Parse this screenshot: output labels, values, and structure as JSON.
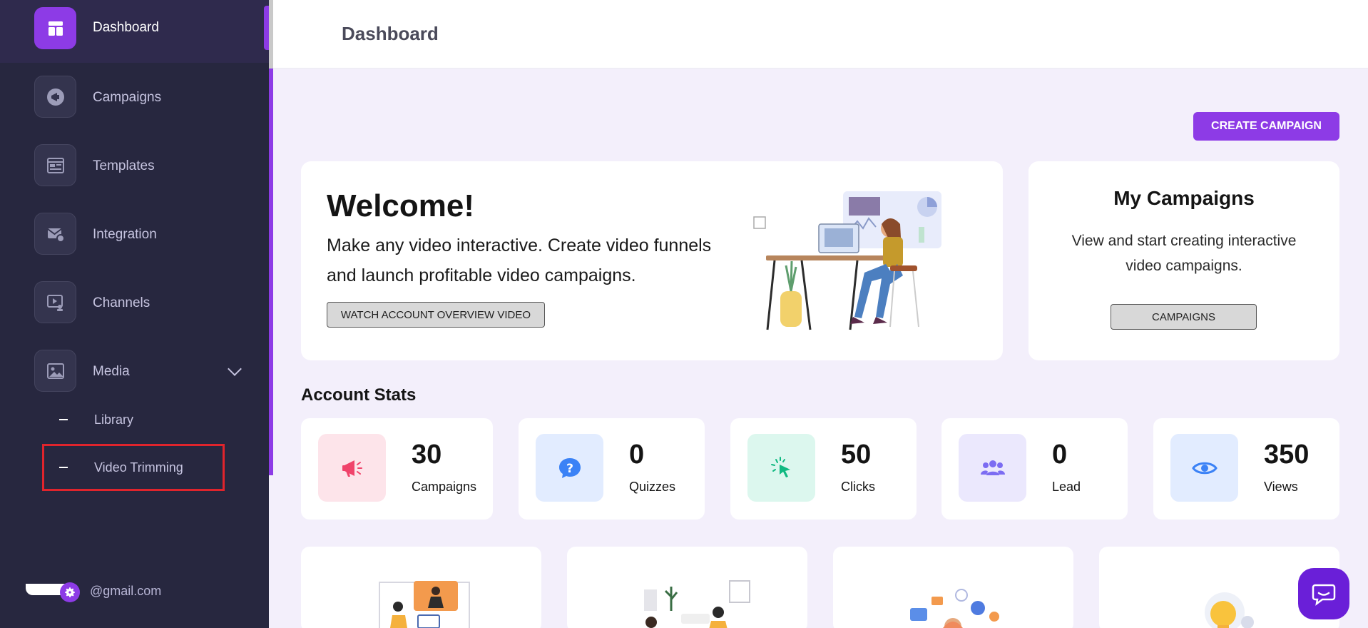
{
  "sidebar": {
    "items": [
      {
        "label": "Dashboard",
        "icon": "dashboard-icon"
      },
      {
        "label": "Campaigns",
        "icon": "megaphone-icon"
      },
      {
        "label": "Templates",
        "icon": "template-icon"
      },
      {
        "label": "Integration",
        "icon": "integration-icon"
      },
      {
        "label": "Channels",
        "icon": "channels-icon"
      },
      {
        "label": "Media",
        "icon": "media-icon"
      }
    ],
    "media_sub": [
      {
        "label": "Library"
      },
      {
        "label": "Video Trimming"
      }
    ],
    "profile_email": "@gmail.com"
  },
  "header": {
    "title": "Dashboard"
  },
  "actions": {
    "create_campaign": "CREATE CAMPAIGN"
  },
  "welcome": {
    "title": "Welcome!",
    "text": "Make any video interactive. Create video funnels and launch profitable video campaigns.",
    "button": "WATCH ACCOUNT OVERVIEW VIDEO"
  },
  "my_campaigns": {
    "title": "My Campaigns",
    "text": "View and start creating interactive video campaigns.",
    "button": "CAMPAIGNS"
  },
  "account_stats": {
    "title": "Account Stats",
    "items": [
      {
        "value": "30",
        "label": "Campaigns",
        "color": "#f0436b",
        "bg": "#fde4ea"
      },
      {
        "value": "0",
        "label": "Quizzes",
        "color": "#3b82f6",
        "bg": "#e2ecff"
      },
      {
        "value": "50",
        "label": "Clicks",
        "color": "#10b981",
        "bg": "#dcf7ee"
      },
      {
        "value": "0",
        "label": "Lead",
        "color": "#7c6cf2",
        "bg": "#ebe8fd"
      },
      {
        "value": "350",
        "label": "Views",
        "color": "#3b82f6",
        "bg": "#e2ecff"
      }
    ]
  },
  "colors": {
    "accent": "#8d3be6",
    "sidebar": "#27273f",
    "highlight": "#e0242c"
  }
}
